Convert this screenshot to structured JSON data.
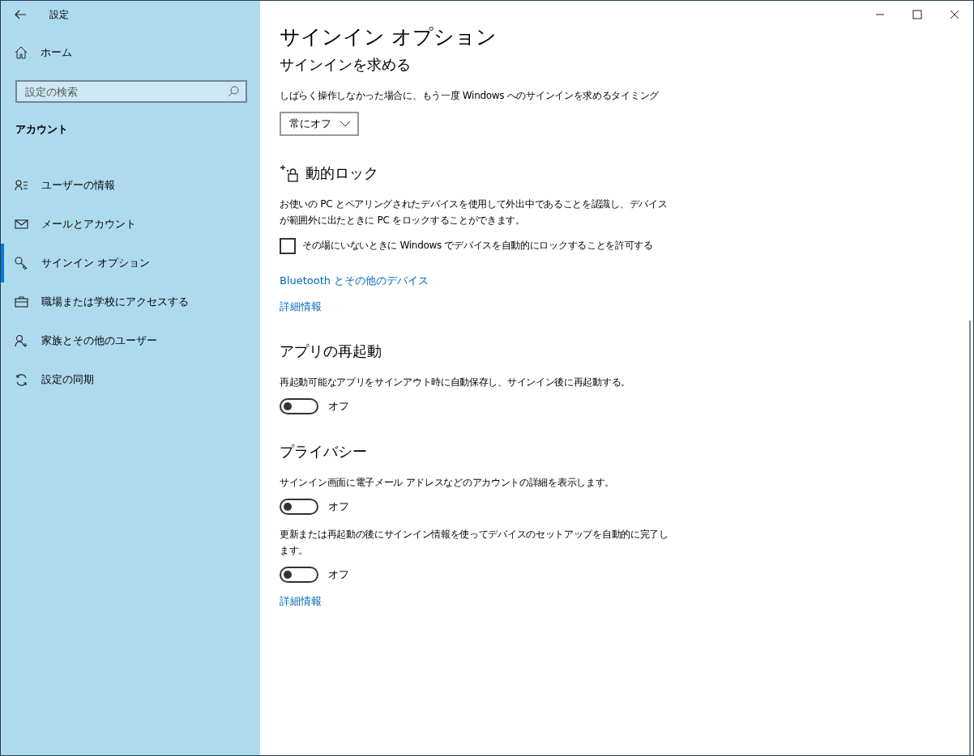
{
  "window": {
    "title": "設定"
  },
  "sidebar": {
    "home": "ホーム",
    "search": {
      "placeholder": "設定の検索"
    },
    "section": "アカウント",
    "items": [
      {
        "label": "ユーザーの情報",
        "selected": false
      },
      {
        "label": "メールとアカウント",
        "selected": false
      },
      {
        "label": "サインイン オプション",
        "selected": true
      },
      {
        "label": "職場または学校にアクセスする",
        "selected": false
      },
      {
        "label": "家族とその他のユーザー",
        "selected": false
      },
      {
        "label": "設定の同期",
        "selected": false
      }
    ]
  },
  "page": {
    "title": "サインイン オプション",
    "sections": [
      {
        "heading": "サインインを求める",
        "items": [
          {
            "kind": "text",
            "text": "しばらく操作しなかった場合に、もう一度 Windows へのサインインを求めるタイミング"
          },
          {
            "kind": "dropdown",
            "value": "常にオフ"
          }
        ]
      },
      {
        "heading": "動的ロック",
        "items": [
          {
            "kind": "text",
            "text": "お使いの PC とペアリングされたデバイスを使用して外出中であることを認識し、デバイスが範囲外に出たときに PC をロックすることができます。"
          },
          {
            "kind": "checkbox",
            "label": "その場にいないときに Windows でデバイスを自動的にロックすることを許可する",
            "checked": false
          },
          {
            "kind": "link",
            "text": "Bluetooth とその他のデバイス"
          },
          {
            "kind": "link",
            "text": "詳細情報"
          }
        ]
      },
      {
        "heading": "アプリの再起動",
        "items": [
          {
            "kind": "text",
            "text": "再起動可能なアプリをサインアウト時に自動保存し、サインイン後に再起動する。"
          },
          {
            "kind": "toggle",
            "on": false,
            "label": "オフ"
          }
        ]
      },
      {
        "heading": "プライバシー",
        "items": [
          {
            "kind": "text",
            "text": "サインイン画面に電子メール アドレスなどのアカウントの詳細を表示します。"
          },
          {
            "kind": "toggle",
            "on": false,
            "label": "オフ"
          },
          {
            "kind": "text",
            "text": "更新または再起動の後にサインイン情報を使ってデバイスのセットアップを自動的に完了します。"
          },
          {
            "kind": "toggle",
            "on": false,
            "label": "オフ"
          },
          {
            "kind": "link",
            "text": "詳細情報"
          }
        ]
      }
    ]
  }
}
